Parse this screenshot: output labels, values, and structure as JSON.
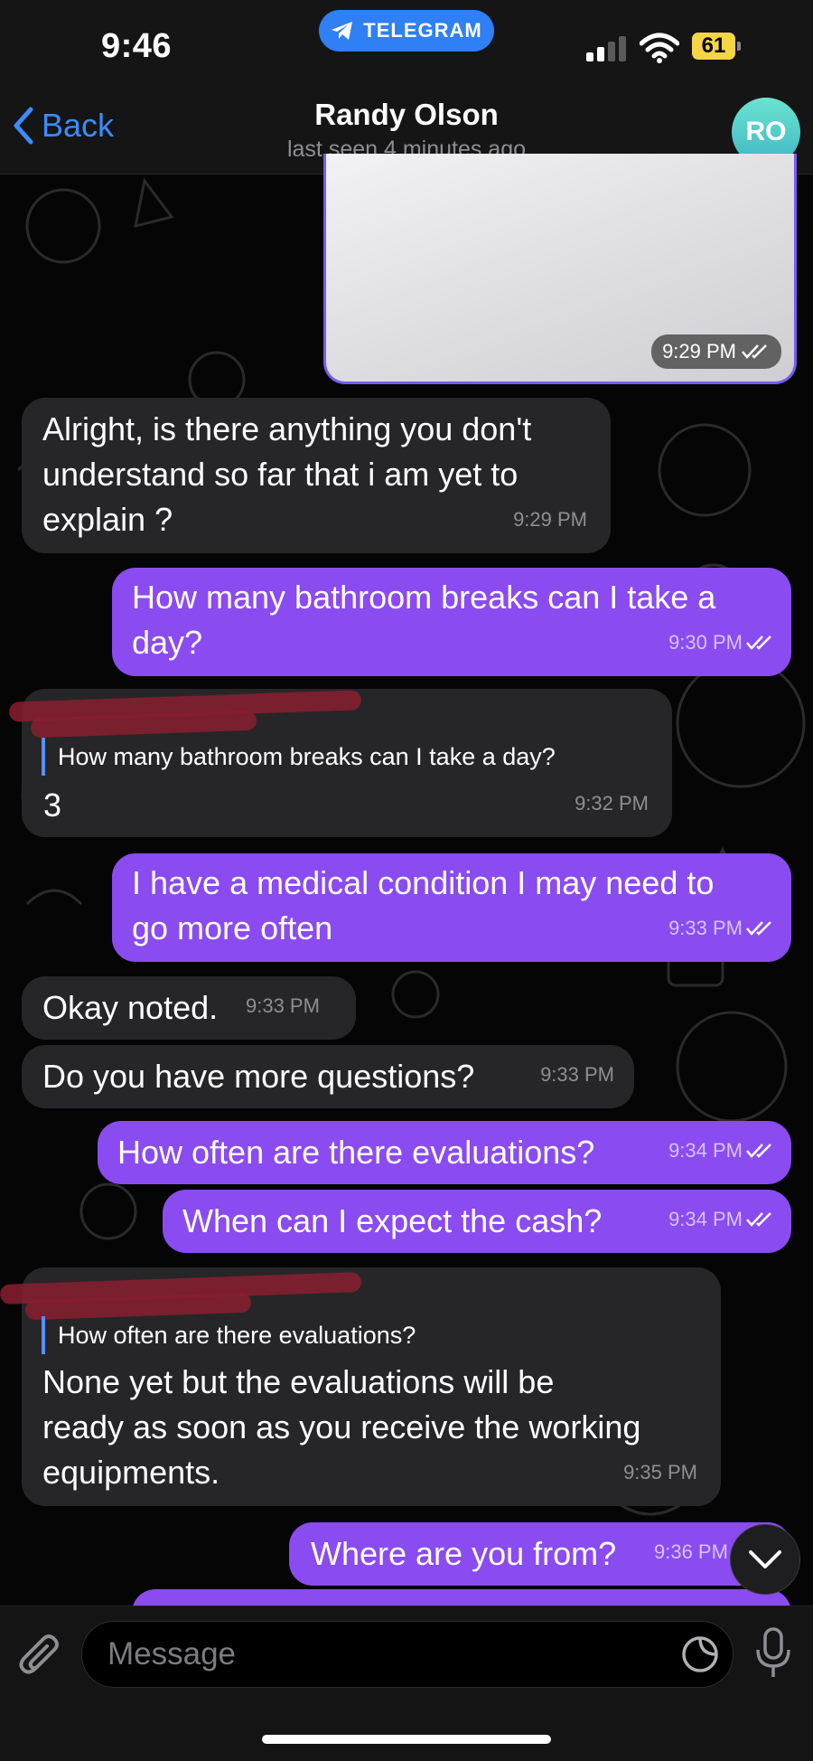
{
  "status_bar": {
    "time": "9:46",
    "app_pill": "TELEGRAM",
    "battery": "61"
  },
  "header": {
    "back_label": "Back",
    "contact_name": "Randy Olson",
    "last_seen": "last seen 4 minutes ago",
    "avatar_initials": "RO"
  },
  "messages": [
    {
      "id": "img",
      "type": "photo",
      "direction": "out",
      "time": "9:29 PM",
      "read": true
    },
    {
      "id": "m1",
      "direction": "in",
      "lines": [
        "Alright, is there anything you don't",
        "understand so far that i am yet to",
        "explain ?"
      ],
      "time": "9:29 PM"
    },
    {
      "id": "m2",
      "direction": "out",
      "lines": [
        "How many bathroom breaks can I take a",
        "day?"
      ],
      "time": "9:30 PM",
      "read": true
    },
    {
      "id": "m3",
      "direction": "in",
      "reply_to": "How many bathroom breaks can I take a day?",
      "lines": [
        "3"
      ],
      "time": "9:32 PM"
    },
    {
      "id": "m4",
      "direction": "out",
      "lines": [
        "I have a medical condition I may need to",
        "go more often"
      ],
      "time": "9:33 PM",
      "read": true
    },
    {
      "id": "m5",
      "direction": "in",
      "lines": [
        "Okay noted."
      ],
      "time": "9:33 PM"
    },
    {
      "id": "m6",
      "direction": "in",
      "lines": [
        "Do you have more questions?"
      ],
      "time": "9:33 PM"
    },
    {
      "id": "m7",
      "direction": "out",
      "lines": [
        "How often are there evaluations?"
      ],
      "time": "9:34 PM",
      "read": true
    },
    {
      "id": "m8",
      "direction": "out",
      "lines": [
        "When can I expect the cash?"
      ],
      "time": "9:34 PM",
      "read": true
    },
    {
      "id": "m9",
      "direction": "in",
      "reply_to": "How often are there evaluations?",
      "lines": [
        "None yet but the evaluations will be",
        "ready as soon as you receive the working",
        "equipments."
      ],
      "time": "9:35 PM"
    },
    {
      "id": "m10",
      "direction": "out",
      "lines": [
        "Where are you from?"
      ],
      "time": "9:36 PM",
      "read": true
    }
  ],
  "input": {
    "placeholder": "Message"
  },
  "icons": {
    "back": "chevron-left-icon",
    "attach": "paperclip-icon",
    "sticker": "sticker-icon",
    "mic": "microphone-icon",
    "scroll": "chevron-down-icon",
    "read": "double-check-icon"
  },
  "colors": {
    "outgoing_bubble": "#8a4bf0",
    "incoming_bubble": "#262628",
    "link_blue": "#3a8cff",
    "telegram_pill": "#2f7ff5"
  }
}
